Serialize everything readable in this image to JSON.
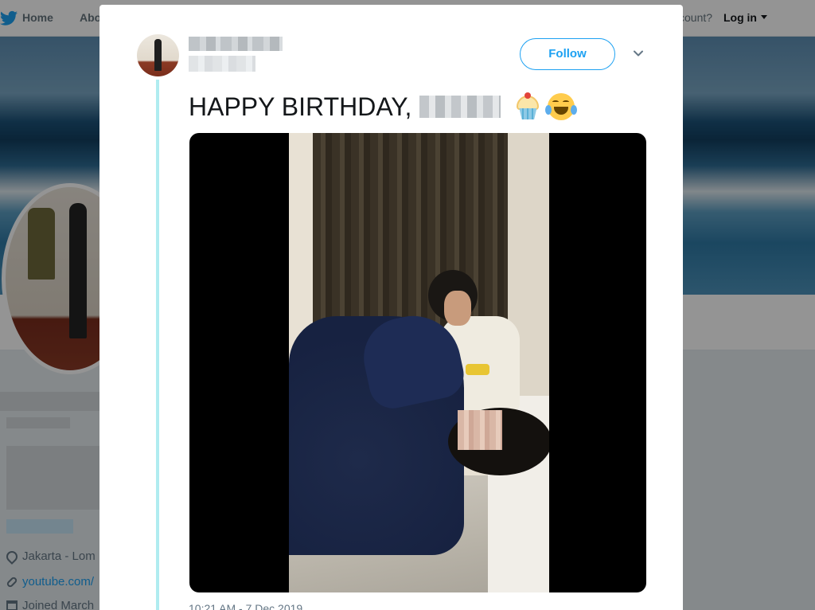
{
  "nav": {
    "home_label": "Home",
    "about_label": "Abo",
    "account_text": "ccount?",
    "login_label": "Log in"
  },
  "profile": {
    "location": "Jakarta - Lom",
    "website": "youtube.com/",
    "joined": "Joined March"
  },
  "tweet": {
    "follow_label": "Follow",
    "text_prefix": "HAPPY BIRTHDAY,",
    "timestamp": "10:21 AM - 7 Dec 2019"
  },
  "icons": {
    "brand": "bird-icon",
    "cupcake": "cupcake-emoji",
    "laughing": "tears-of-joy-emoji",
    "chevron": "chevron-down-icon"
  },
  "colors": {
    "accent": "#1da1f2",
    "thread_line": "#b0ecf0",
    "text_primary": "#14171a",
    "text_secondary": "#657786"
  }
}
